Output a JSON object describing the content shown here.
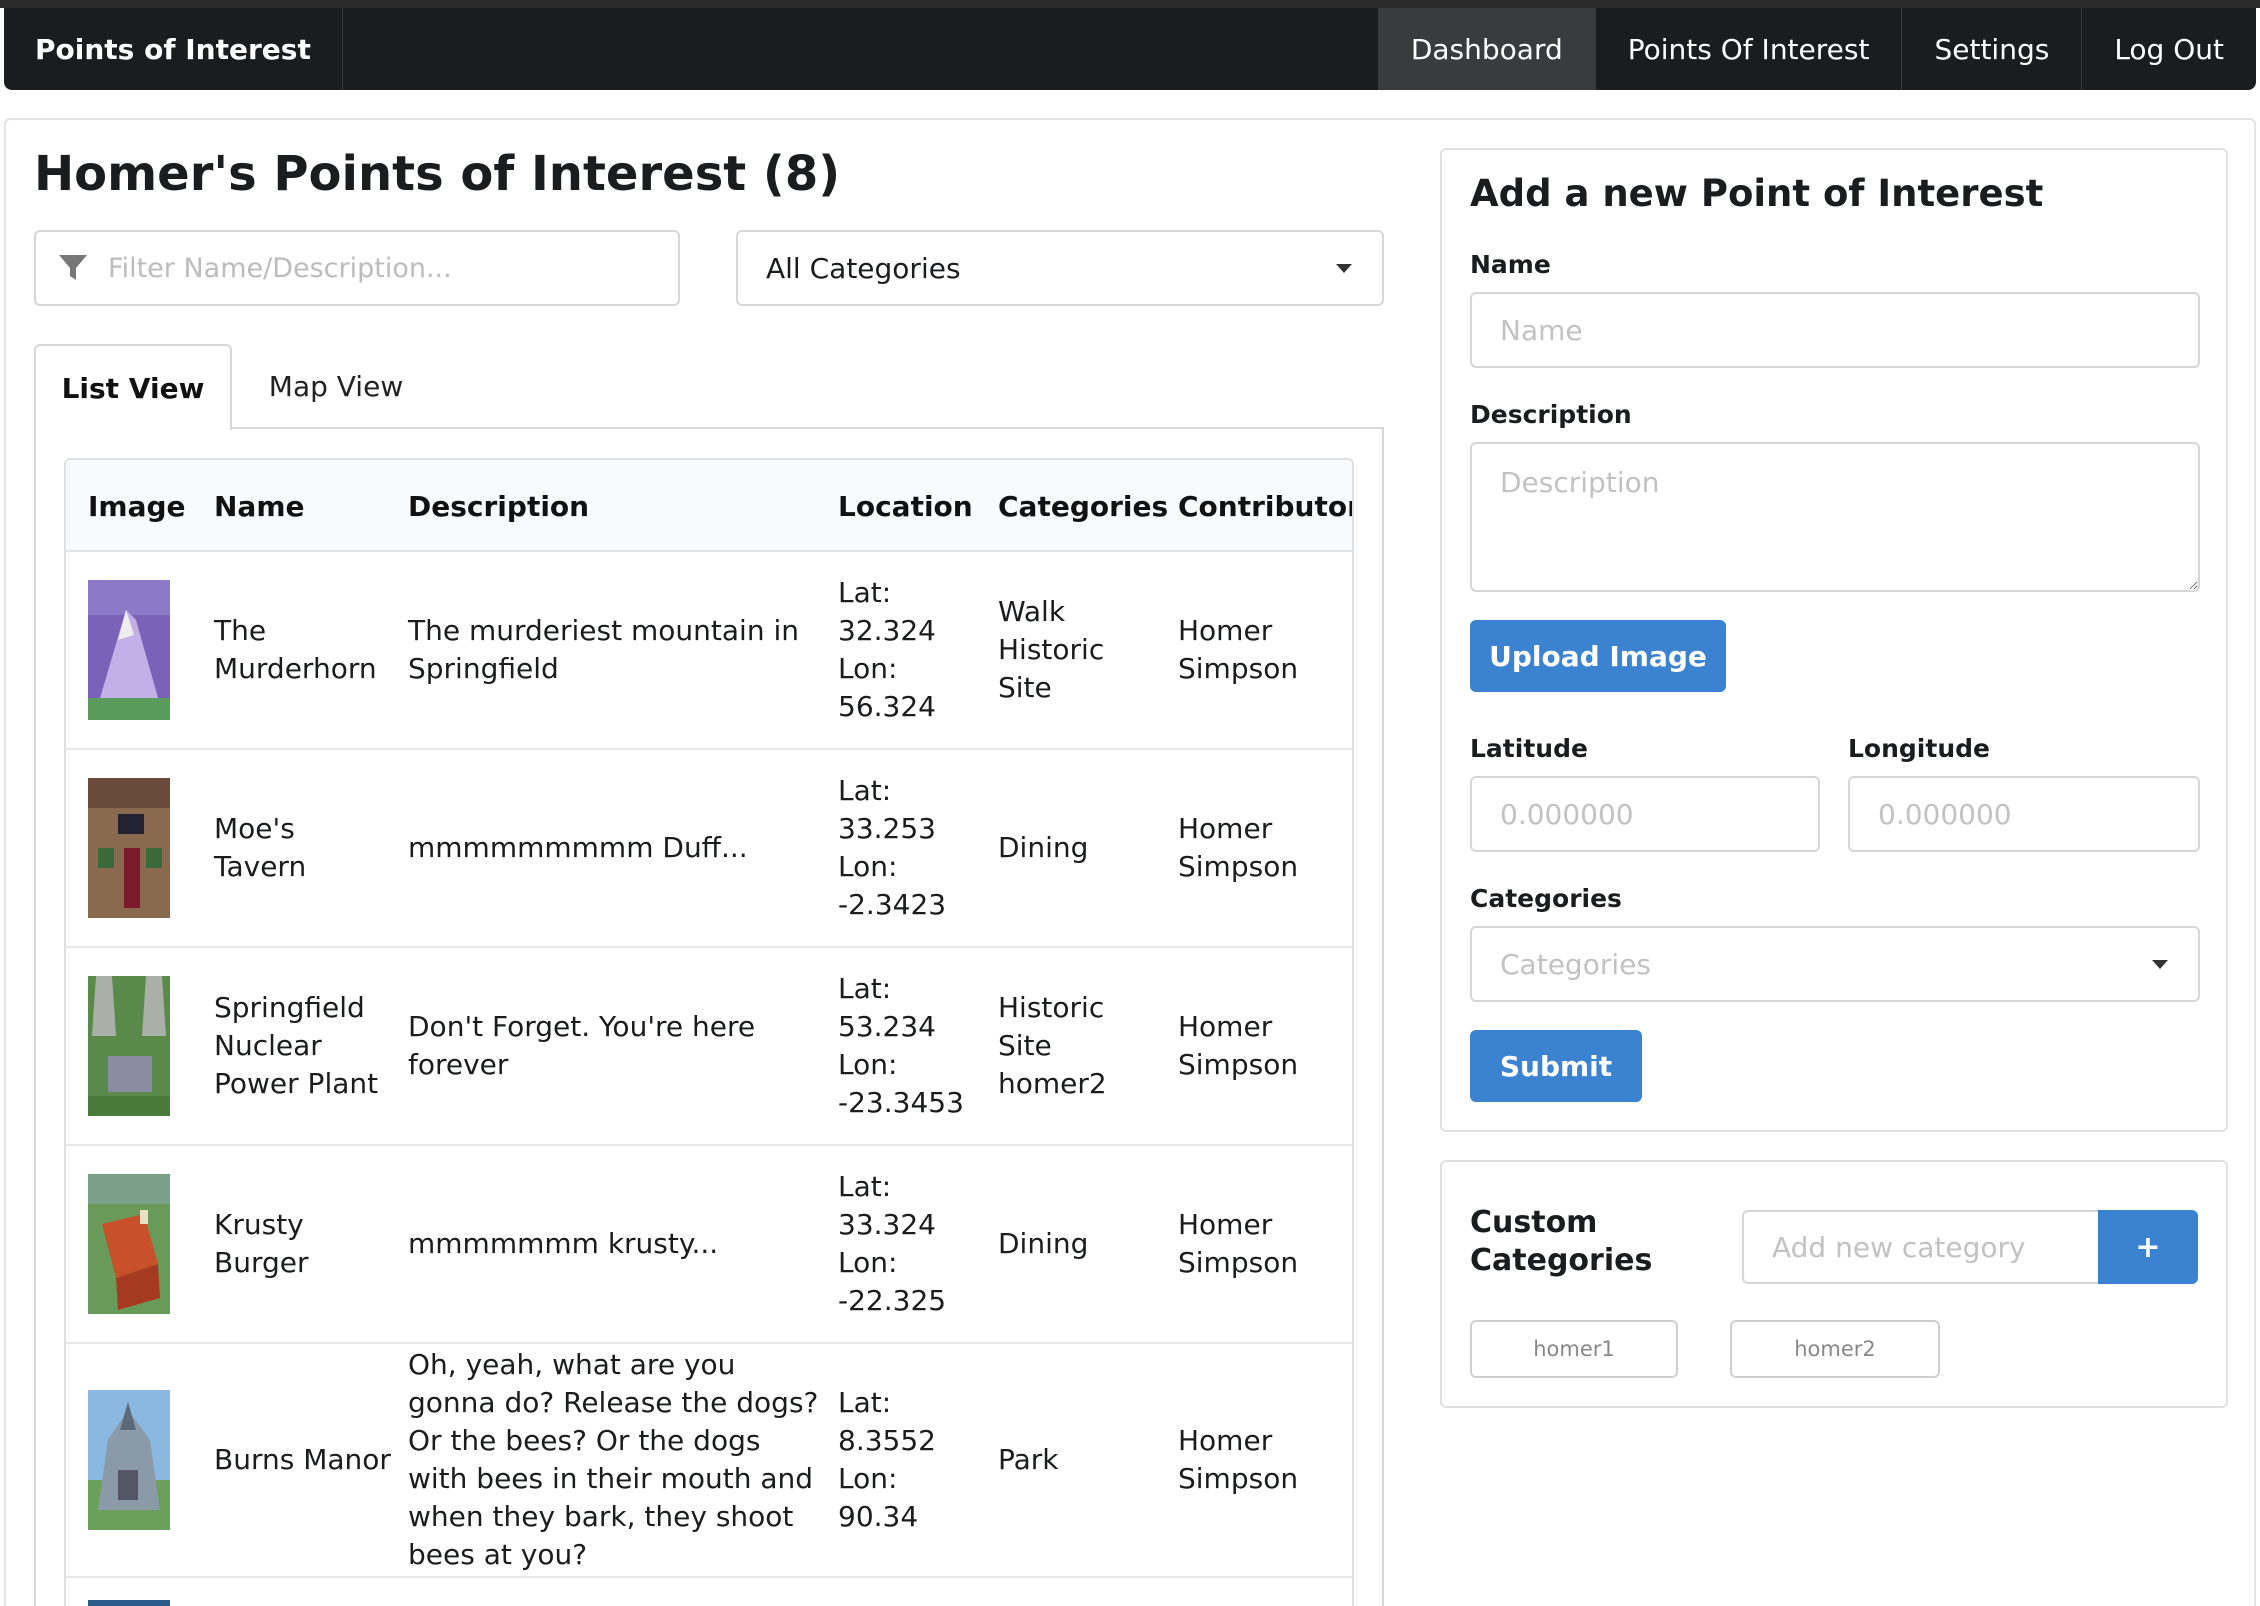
{
  "nav": {
    "brand": "Points of Interest",
    "items": [
      "Dashboard",
      "Points Of Interest",
      "Settings",
      "Log Out"
    ],
    "active": "Dashboard"
  },
  "page": {
    "title": "Homer's Points of Interest (8)",
    "filter_placeholder": "Filter Name/Description...",
    "category_filter_value": "All Categories"
  },
  "tabs": [
    {
      "label": "List View",
      "active": true
    },
    {
      "label": "Map View",
      "active": false
    }
  ],
  "table": {
    "headers": [
      "Image",
      "Name",
      "Description",
      "Location",
      "Categories",
      "Contributor"
    ],
    "rows": [
      {
        "image": "murderhorn-thumbnail",
        "name": "The Murderhorn",
        "description": "The murderiest mountain in Springfield",
        "lat": "Lat: 32.324",
        "lon": "Lon: 56.324",
        "categories": [
          "Walk",
          "Historic Site"
        ],
        "contributor": "Homer Simpson"
      },
      {
        "image": "moes-tavern-thumbnail",
        "name": "Moe's Tavern",
        "description": "mmmmmmmmm Duff...",
        "lat": "Lat: 33.253",
        "lon": "Lon: -2.3423",
        "categories": [
          "Dining"
        ],
        "contributor": "Homer Simpson"
      },
      {
        "image": "nuclear-plant-thumbnail",
        "name": "Springfield Nuclear Power Plant",
        "description": "Don't Forget. You're here forever",
        "lat": "Lat: 53.234",
        "lon": "Lon: -23.3453",
        "categories": [
          "Historic Site",
          "homer2"
        ],
        "contributor": "Homer Simpson"
      },
      {
        "image": "krusty-burger-thumbnail",
        "name": "Krusty Burger",
        "description": "mmmmmmm krusty...",
        "lat": "Lat: 33.324",
        "lon": "Lon: -22.325",
        "categories": [
          "Dining"
        ],
        "contributor": "Homer Simpson"
      },
      {
        "image": "burns-manor-thumbnail",
        "name": "Burns Manor",
        "description": "Oh, yeah, what are you gonna do? Release the dogs? Or the bees? Or the dogs with bees in their mouth and when they bark, they shoot bees at you?",
        "lat": "Lat: 8.3552",
        "lon": "Lon: 90.34",
        "categories": [
          "Park"
        ],
        "contributor": "Homer Simpson"
      }
    ]
  },
  "form": {
    "title": "Add a new Point of Interest",
    "name_label": "Name",
    "name_placeholder": "Name",
    "description_label": "Description",
    "description_placeholder": "Description",
    "upload_label": "Upload Image",
    "latitude_label": "Latitude",
    "latitude_placeholder": "0.000000",
    "longitude_label": "Longitude",
    "longitude_placeholder": "0.000000",
    "categories_label": "Categories",
    "categories_placeholder": "Categories",
    "submit_label": "Submit"
  },
  "custom_categories": {
    "title": "Custom Categories",
    "input_placeholder": "Add new category",
    "add_label": "+",
    "chips": [
      "homer1",
      "homer2"
    ]
  },
  "colors": {
    "navbar": "#1b1c1d",
    "primary_button": "#3b83d1",
    "border": "#d6d6d6"
  }
}
